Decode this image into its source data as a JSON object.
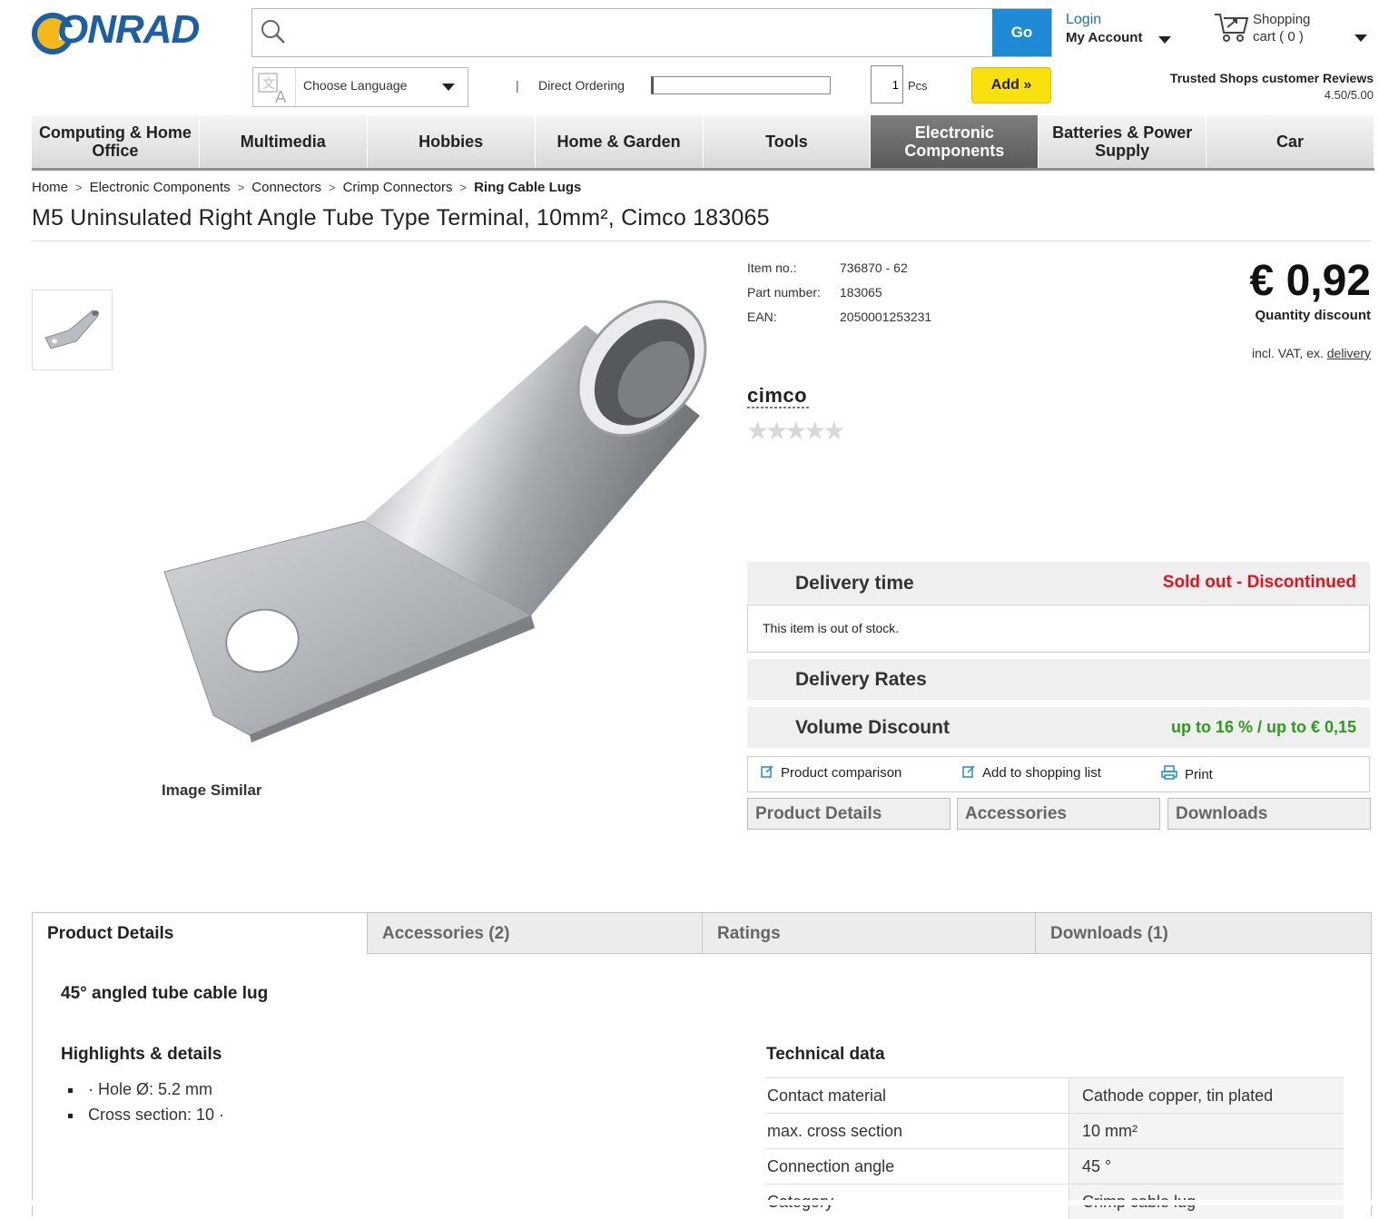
{
  "brand": {
    "logo_text": "ONRAD",
    "colors": {
      "primary": "#1d5fa6",
      "accent": "#f4b81a"
    }
  },
  "header": {
    "search_placeholder": "",
    "go_label": "Go",
    "login_label": "Login",
    "account_label": "My Account",
    "cart_title": "Shopping",
    "cart_count": "cart ( 0 )",
    "language_label": "Choose Language",
    "separator": "|",
    "direct_ordering_label": "Direct Ordering",
    "qty_value": "1",
    "qty_unit": "Pcs",
    "add_label": "Add »",
    "trusted_label": "Trusted Shops customer Reviews",
    "trusted_score": "4.50/5.00"
  },
  "nav": {
    "items": [
      {
        "label": "Computing & Home Office"
      },
      {
        "label": "Multimedia"
      },
      {
        "label": "Hobbies"
      },
      {
        "label": "Home & Garden"
      },
      {
        "label": "Tools"
      },
      {
        "label": "Electronic Components",
        "active": true
      },
      {
        "label": "Batteries & Power Supply"
      },
      {
        "label": "Car"
      }
    ]
  },
  "breadcrumb": {
    "items": [
      "Home",
      "Electronic Components",
      "Connectors",
      "Crimp Connectors"
    ],
    "current": "Ring Cable Lugs",
    "separator": ">"
  },
  "product": {
    "title": "M5 Uninsulated Right Angle Tube Type Terminal, 10mm², Cimco 183065",
    "image_caption": "Image Similar",
    "specs": [
      {
        "label": "Item no.:",
        "value": "736870 - 62"
      },
      {
        "label": "Part number:",
        "value": "183065"
      },
      {
        "label": "EAN:",
        "value": "2050001253231"
      }
    ],
    "price": "€ 0,92",
    "quantity_discount": "Quantity discount",
    "vat_prefix": "incl. VAT, ex.",
    "vat_link": "delivery",
    "brand_name": "cimco",
    "rating_stars": "★★★★★",
    "rating_value": 0
  },
  "delivery": {
    "time_label": "Delivery time",
    "status": "Sold out - Discontinued",
    "status_color": "#e3131b",
    "stock_message": "This item is out of stock.",
    "rates_label": "Delivery Rates",
    "volume_label": "Volume Discount",
    "volume_value": "up to 16 % / up to € 0,15",
    "volume_color": "#2e9a1c"
  },
  "actions": {
    "compare_label": "Product comparison",
    "shopping_list_label": "Add to shopping list",
    "print_label": "Print"
  },
  "sub_tabs": [
    "Product Details",
    "Accessories",
    "Downloads"
  ],
  "tabs": [
    {
      "label": "Product Details",
      "active": true
    },
    {
      "label": "Accessories  (2)"
    },
    {
      "label": "Ratings"
    },
    {
      "label": "Downloads  (1)"
    }
  ],
  "details": {
    "heading": "45° angled tube cable lug",
    "highlights_heading": "Highlights & details",
    "highlights": [
      "· Hole Ø: 5.2 mm",
      "Cross section: 10 ·"
    ],
    "tech_heading": "Technical data",
    "tech": [
      {
        "key": "Contact material",
        "value": "Cathode copper, tin plated"
      },
      {
        "key": "max. cross section",
        "value": "10 mm²"
      },
      {
        "key": "Connection angle",
        "value": "45 °"
      },
      {
        "key": "Category",
        "value": "Crimp cable lug"
      }
    ]
  }
}
